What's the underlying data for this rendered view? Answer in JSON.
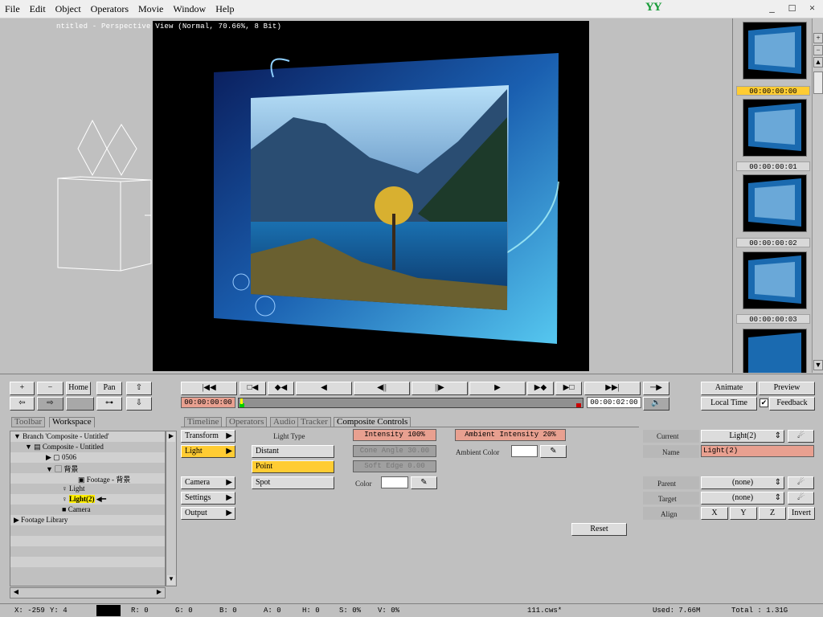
{
  "menu": [
    "File",
    "Edit",
    "Object",
    "Operators",
    "Movie",
    "Window",
    "Help"
  ],
  "logo": "YY",
  "window_controls": [
    "_",
    "□",
    "×"
  ],
  "viewport": {
    "title": "ntitled - Perspective View (Normal, 70.66%, 8 Bit)"
  },
  "thumbs": [
    "00:00:00:00",
    "00:00:00:01",
    "00:00:00:02",
    "00:00:00:03"
  ],
  "nav": {
    "plus": "+",
    "minus": "−",
    "home": "Home",
    "pan": "Pan"
  },
  "transport": {
    "first": "|◀◀",
    "markin": "□◀",
    "keyprev": "◆◀",
    "stepback": "◀",
    "playback": "◀||",
    "playfwd": "||▶",
    "play": "▶",
    "keynext": "▶◆",
    "markout": "▶□",
    "last": "▶▶|",
    "loop": "─▶",
    "current_time": "00:00:00:00",
    "end_time": "00:00:02:00"
  },
  "right_buttons": {
    "animate": "Animate",
    "preview": "Preview",
    "localtime": "Local Time",
    "feedback": "Feedback"
  },
  "tabs_left": [
    "Toolbar",
    "Workspace"
  ],
  "tabs_right": [
    "Timeline",
    "Operators",
    "Audio",
    "Tracker",
    "Composite Controls"
  ],
  "tree": [
    {
      "text": "Branch 'Composite - Untitled'",
      "indent": 0
    },
    {
      "text": "Composite - Untitled",
      "indent": 1
    },
    {
      "text": "0506",
      "indent": 2
    },
    {
      "text": "背景",
      "indent": 2
    },
    {
      "text": "Footage - 背景",
      "indent": 3
    },
    {
      "text": "Light",
      "indent": 2
    },
    {
      "text": "Light(2)",
      "indent": 2
    },
    {
      "text": "Camera",
      "indent": 2
    },
    {
      "text": "Footage Library",
      "indent": 0
    }
  ],
  "categories": [
    "Transform",
    "Light",
    "Camera",
    "Settings",
    "Output"
  ],
  "light": {
    "type_label": "Light Type",
    "types": [
      "Distant",
      "Point",
      "Spot"
    ],
    "selected": "Point",
    "intensity": "Intensity 100%",
    "cone_angle": "Cone Angle 30.00",
    "soft_edge": "Soft Edge 0.00",
    "color_label": "Color",
    "ambient": "Ambient Intensity 20%",
    "ambient_color": "Ambient Color"
  },
  "props": {
    "current_label": "Current",
    "current_value": "Light(2)",
    "name_label": "Name",
    "name_value": "Light(2)",
    "parent_label": "Parent",
    "parent_value": "(none)",
    "target_label": "Target",
    "target_value": "(none)",
    "align_label": "Align",
    "align": [
      "X",
      "Y",
      "Z",
      "Invert"
    ],
    "reset": "Reset"
  },
  "status": {
    "x": "X: -259",
    "y": "Y: 4",
    "r": "R: 0",
    "g": "G: 0",
    "b": "B: 0",
    "a": "A: 0",
    "h": "H: 0",
    "s": "S: 0%",
    "v": "V: 0%",
    "file": "111.cws*",
    "used": "Used: 7.66M",
    "total": "Total : 1.31G"
  },
  "colors": {
    "accent": "#ffcc33",
    "pink": "#e8a090",
    "sky": "#4ab0e0"
  }
}
